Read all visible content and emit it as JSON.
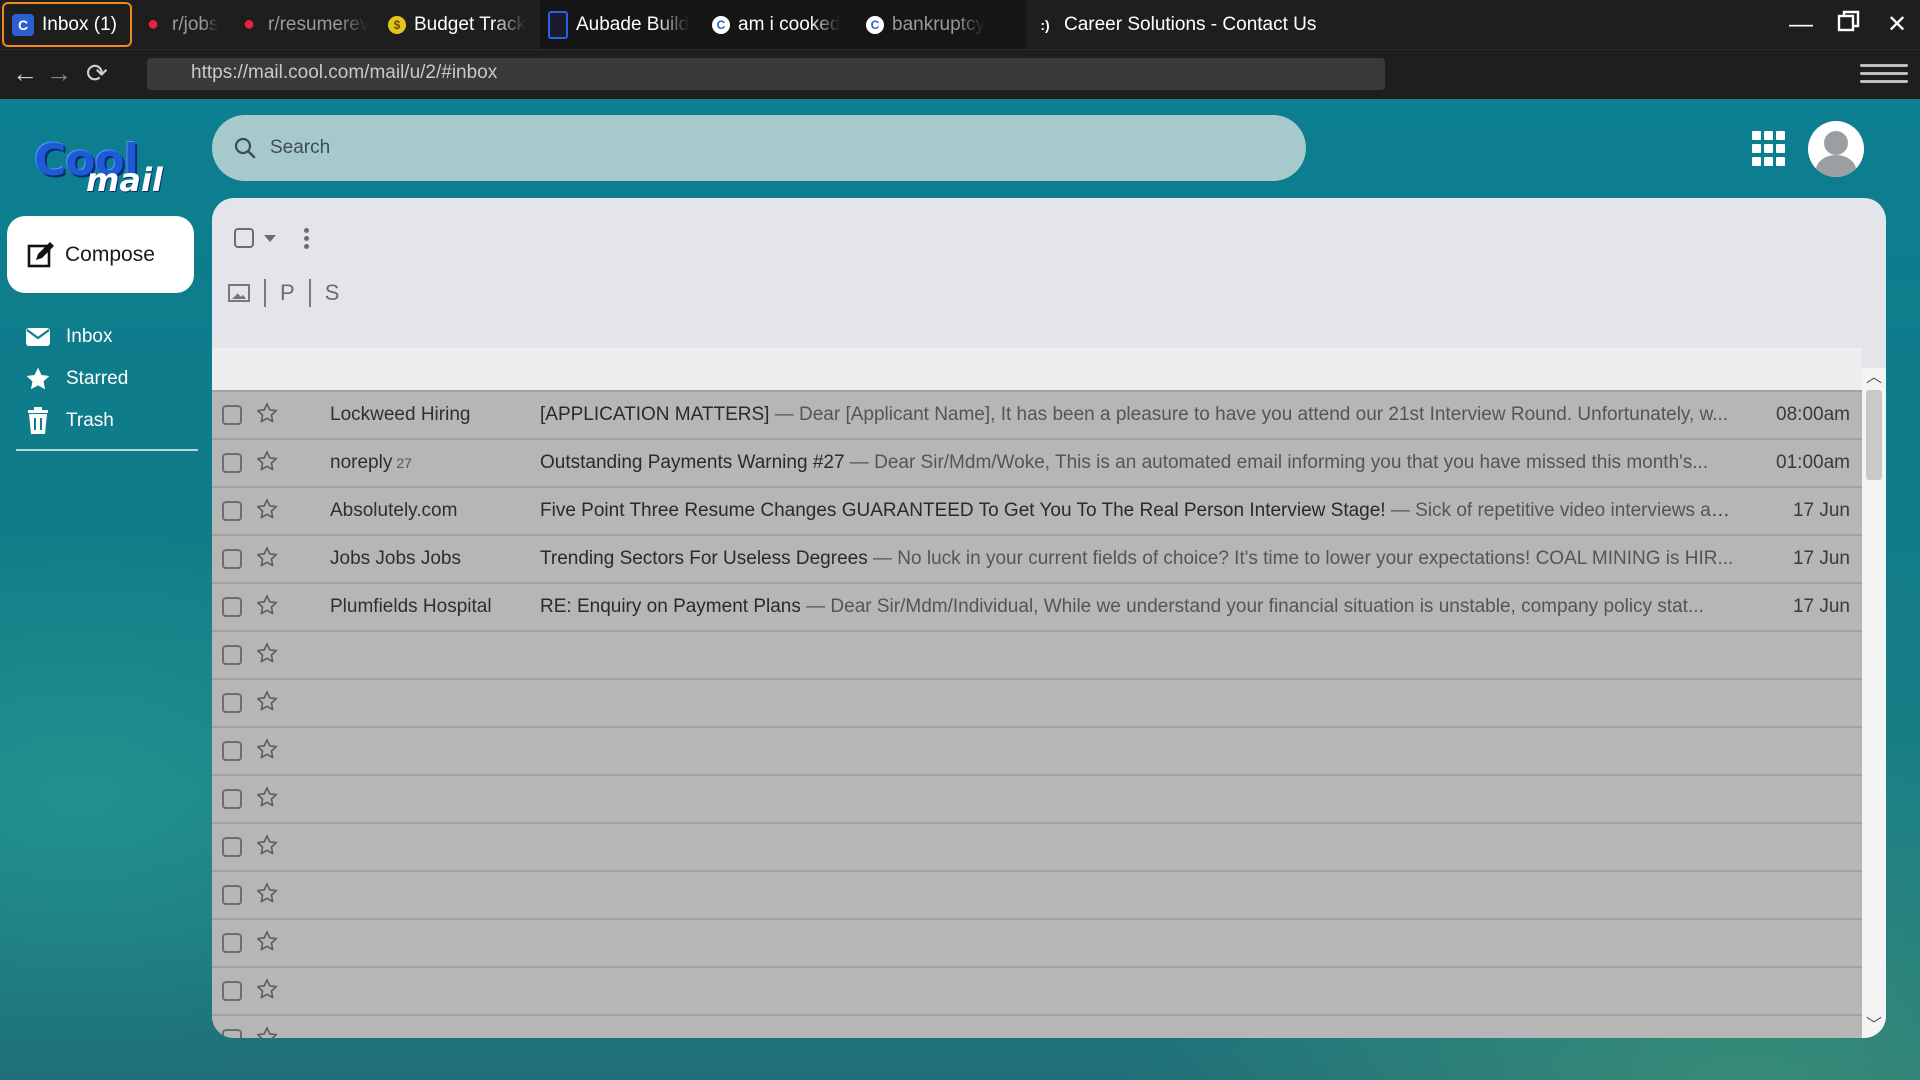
{
  "browser": {
    "tabs": [
      {
        "label": "Inbox (1)",
        "icon": "coolmail-favicon",
        "active": true
      },
      {
        "label": "r/jobs",
        "icon": "reddit-favicon"
      },
      {
        "label": "r/resumerev",
        "icon": "reddit-favicon"
      },
      {
        "label": "Budget Track",
        "icon": "coin-favicon"
      },
      {
        "label": "Aubade Build",
        "icon": "u-favicon"
      },
      {
        "label": "am i cooked",
        "icon": "g-favicon"
      },
      {
        "label": "bankruptcy",
        "icon": "g-favicon"
      },
      {
        "label": "Career Solutions - Contact Us!",
        "icon": "cs-favicon"
      }
    ],
    "url": "https://mail.cool.com/mail/u/2/#inbox"
  },
  "logo": {
    "part1": "Cool",
    "part2": "mail"
  },
  "search": {
    "placeholder": "Search"
  },
  "compose": {
    "label": "Compose"
  },
  "nav": [
    {
      "label": "Inbox",
      "icon": "envelope-icon"
    },
    {
      "label": "Starred",
      "icon": "star-icon"
    },
    {
      "label": "Trash",
      "icon": "trash-icon"
    }
  ],
  "categories": {
    "primary": "P",
    "social": "S"
  },
  "emails": [
    {
      "sender": "Lockweed Hiring",
      "count": "",
      "subject": "[APPLICATION MATTERS]",
      "snippet": "Dear [Applicant Name],  It has been a pleasure to have you attend our 21st Interview Round. Unfortunately, w...",
      "time": "08:00am"
    },
    {
      "sender": "noreply",
      "count": "27",
      "subject": "Outstanding Payments Warning #27",
      "snippet": "Dear Sir/Mdm/Woke,  This is an automated email informing you that you have missed this month's...",
      "time": "01:00am"
    },
    {
      "sender": "Absolutely.com",
      "count": "",
      "subject": "Five Point Three Resume Changes GUARANTEED To Get You To The Real Person Interview Stage!",
      "snippet": "Sick of repetitive video interviews and...",
      "time": "17 Jun"
    },
    {
      "sender": "Jobs Jobs Jobs",
      "count": "",
      "subject": "Trending Sectors For Useless Degrees",
      "snippet": "No luck in your current fields of choice? It's time to lower your expectations! COAL MINING is HIR...",
      "time": "17 Jun"
    },
    {
      "sender": "Plumfields Hospital",
      "count": "",
      "subject": "RE: Enquiry on Payment Plans",
      "snippet": "Dear Sir/Mdm/Individual,  While we understand your financial situation is unstable, company policy stat...",
      "time": "17 Jun"
    }
  ],
  "separator": " — ",
  "colors": {
    "accent": "#f08a1a",
    "brand_blue": "#1f5ad6",
    "row_bg": "#b6b6b6",
    "search_bg": "#a6c9cc"
  }
}
